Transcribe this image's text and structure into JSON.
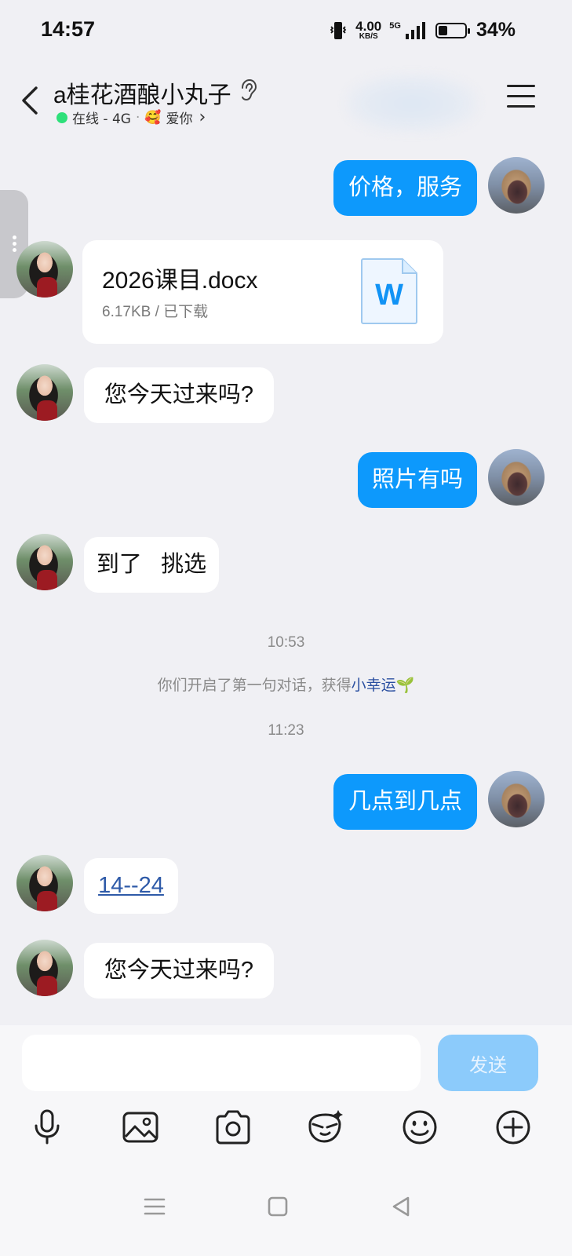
{
  "status_bar": {
    "time": "14:57",
    "net_speed": "4.00",
    "net_unit": "KB/S",
    "network": "5G",
    "battery_percent": "34%",
    "battery_level": 0.34
  },
  "header": {
    "title": "a桂花酒酿小丸子",
    "status_text": "在线 - 4G",
    "separator": "·",
    "mood_emoji": "🥰",
    "mood_text": "爱你",
    "chevron": "›"
  },
  "messages": [
    {
      "side": "me",
      "text": "价格，服务"
    },
    {
      "side": "her",
      "type": "file",
      "file_name": "2026课目.docx",
      "file_meta": "6.17KB / 已下载",
      "file_icon_letter": "W"
    },
    {
      "side": "her",
      "text": "您今天过来吗?"
    },
    {
      "side": "me",
      "text": "照片有吗"
    },
    {
      "side": "her",
      "text": "到了   挑选"
    },
    {
      "side": "me",
      "text": "几点到几点"
    },
    {
      "side": "her",
      "text": "14--24",
      "link": true
    },
    {
      "side": "her",
      "text": "您今天过来吗?"
    }
  ],
  "timestamps": [
    "10:53",
    "11:23"
  ],
  "system_message": {
    "text": "你们开启了第一句对话，获得",
    "highlight": "小幸运",
    "emoji": "🌱"
  },
  "input": {
    "placeholder": "",
    "send_label": "发送"
  },
  "toolbar_icons": [
    "microphone-icon",
    "image-icon",
    "camera-icon",
    "sticker-icon",
    "emoji-icon",
    "plus-icon"
  ],
  "colors": {
    "my_bubble": "#0d99fc",
    "her_bubble": "#ffffff",
    "background": "#f0f0f4",
    "send_button": "#8ccbfb",
    "online_dot": "#2ee07a"
  }
}
